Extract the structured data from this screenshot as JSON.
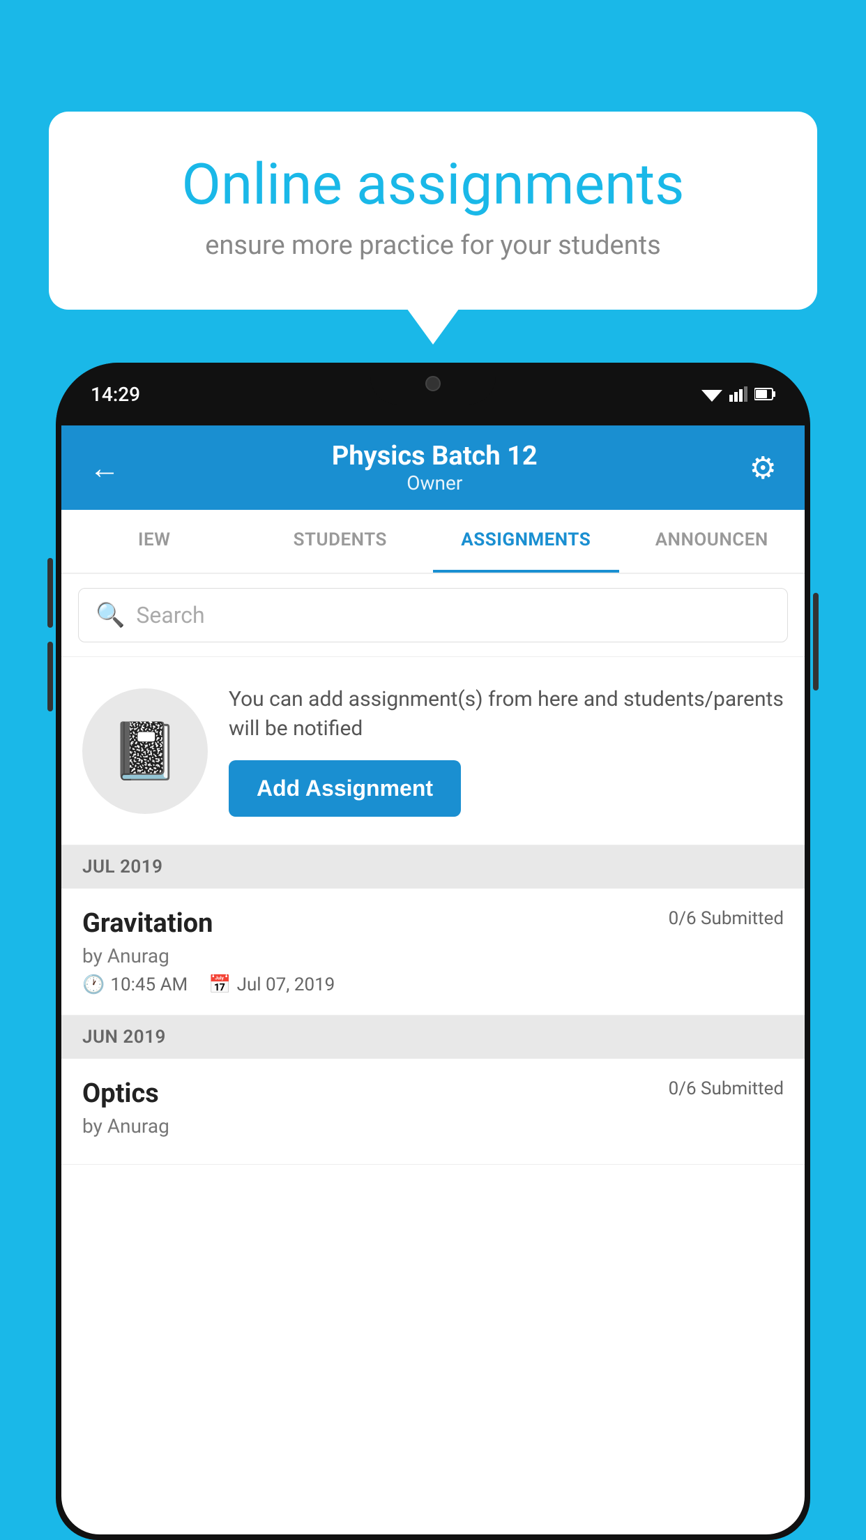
{
  "background_color": "#1ab8e8",
  "speech_bubble": {
    "title": "Online assignments",
    "subtitle": "ensure more practice for your students"
  },
  "phone": {
    "time": "14:29",
    "header": {
      "title": "Physics Batch 12",
      "subtitle": "Owner",
      "back_label": "←",
      "gear_label": "⚙"
    },
    "tabs": [
      {
        "label": "IEW",
        "active": false
      },
      {
        "label": "STUDENTS",
        "active": false
      },
      {
        "label": "ASSIGNMENTS",
        "active": true
      },
      {
        "label": "ANNOUNCEN",
        "active": false
      }
    ],
    "search": {
      "placeholder": "Search"
    },
    "promo": {
      "text": "You can add assignment(s) from here and students/parents will be notified",
      "button_label": "Add Assignment"
    },
    "sections": [
      {
        "label": "JUL 2019",
        "items": [
          {
            "name": "Gravitation",
            "submitted": "0/6 Submitted",
            "by": "by Anurag",
            "time": "10:45 AM",
            "date": "Jul 07, 2019"
          }
        ]
      },
      {
        "label": "JUN 2019",
        "items": [
          {
            "name": "Optics",
            "submitted": "0/6 Submitted",
            "by": "by Anurag",
            "time": "",
            "date": ""
          }
        ]
      }
    ]
  }
}
